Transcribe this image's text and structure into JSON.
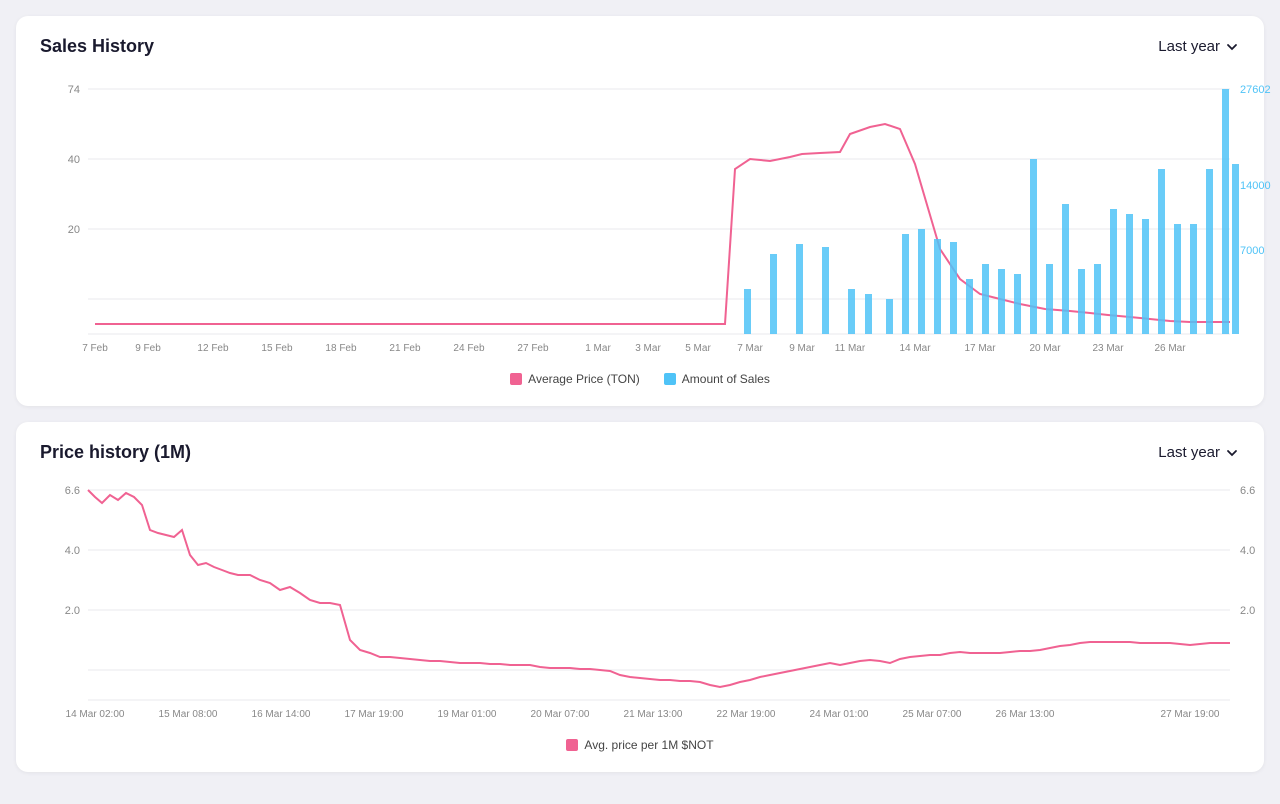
{
  "salesHistory": {
    "title": "Sales History",
    "period": "Last year",
    "legend": {
      "avgPrice": "Average Price (TON)",
      "amountSales": "Amount of Sales"
    },
    "leftAxis": [
      "74",
      "40",
      "20"
    ],
    "rightAxis": [
      "27602",
      "14000",
      "7000"
    ],
    "xLabels": [
      "7 Feb",
      "9 Feb",
      "12 Feb",
      "15 Feb",
      "18 Feb",
      "21 Feb",
      "24 Feb",
      "27 Feb",
      "1 Mar",
      "3 Mar",
      "5 Mar",
      "7 Mar",
      "9 Mar",
      "11 Mar",
      "14 Mar",
      "17 Mar",
      "20 Mar",
      "23 Mar",
      "26 Mar"
    ]
  },
  "priceHistory": {
    "title": "Price history (1M)",
    "period": "Last year",
    "legend": {
      "avgPrice": "Avg. price per 1M $NOT"
    },
    "leftAxis": [
      "6.6",
      "4.0",
      "2.0"
    ],
    "rightAxis": [
      "6.6",
      "4.0",
      "2.0"
    ],
    "xLabels": [
      "14 Mar 02:00",
      "15 Mar 08:00",
      "16 Mar 14:00",
      "17 Mar 19:00",
      "19 Mar 01:00",
      "20 Mar 07:00",
      "21 Mar 13:00",
      "22 Mar 19:00",
      "24 Mar 01:00",
      "25 Mar 07:00",
      "26 Mar 13:00",
      "27 Mar 19:00"
    ]
  },
  "colors": {
    "pink": "#f06292",
    "blue": "#4fc3f7",
    "gridLine": "#e8e8ee",
    "axisText": "#888",
    "chevron": "#1a1a2e"
  }
}
